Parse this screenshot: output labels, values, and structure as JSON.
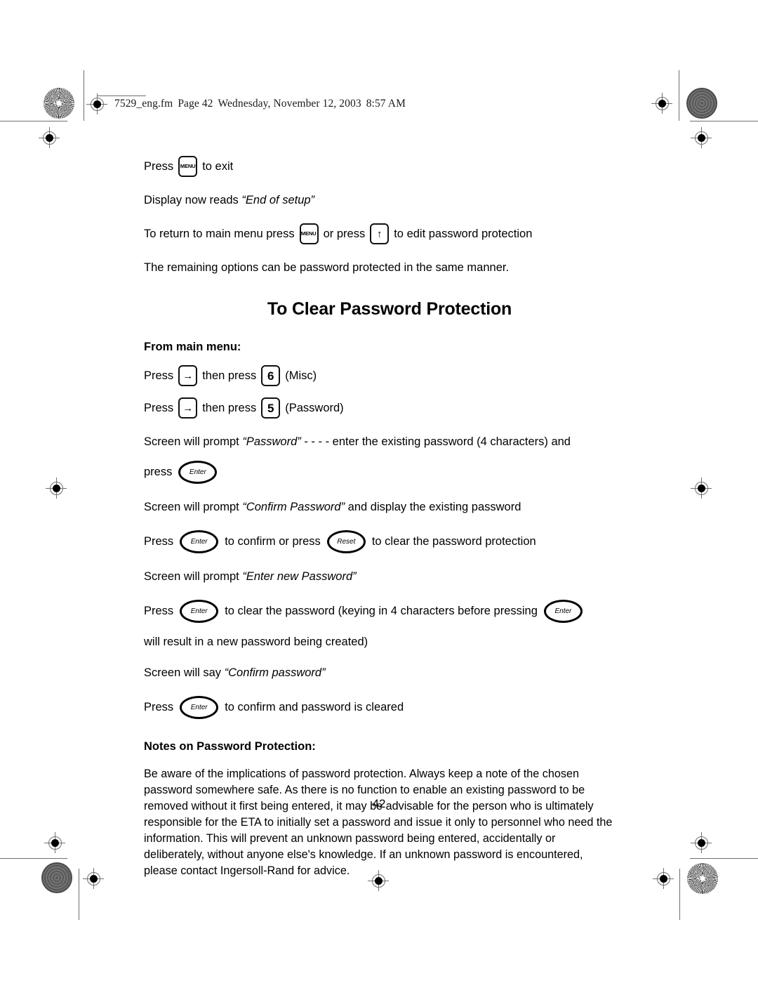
{
  "document": {
    "header_slug": {
      "filename": "7529_eng.fm",
      "page_label": "Page 42",
      "date": "Wednesday, November 12, 2003",
      "time": "8:57 AM"
    },
    "page_number": "42",
    "title": "To Clear Password Protection",
    "subhead": "From main menu:",
    "notes_heading": "Notes on Password Protection:",
    "notes_body": "Be aware of the implications of password protection. Always keep a note of the chosen password somewhere safe. As there is no function to enable an existing password to be removed without it first being entered, it may be advisable for the person who is ultimately responsible for the ETA to initially set a password and issue it only to personnel who need the information. This will prevent an unknown password being entered, accidentally or deliberately, without anyone else's knowledge. If an unknown password is encountered, please contact Ingersoll-Rand for advice."
  },
  "keys": {
    "menu": "MENU",
    "up_arrow": "↑",
    "right_arrow": "→",
    "six": "6",
    "five": "5",
    "enter": "Enter",
    "reset": "Reset"
  },
  "lines": {
    "l1_a": "Press",
    "l1_b": "to exit",
    "l2_a": "Display now reads ",
    "l2_italic": "“End of setup”",
    "l3_a": "To return to main menu press",
    "l3_b": "or press",
    "l3_c": "to edit password protection",
    "l4": "The remaining options can be password protected in the same manner.",
    "l5_a": "Press",
    "l5_b": "then press",
    "l5_c": "(Misc)",
    "l6_a": "Press",
    "l6_b": "then press",
    "l6_c": "(Password)",
    "l7_a": "Screen will prompt ",
    "l7_italic": "“Password”",
    "l7_b": " - - - - enter the existing password (4 characters) and",
    "l8_a": "press",
    "l9_a": "Screen will prompt ",
    "l9_italic": "“Confirm Password”",
    "l9_b": " and display the existing password",
    "l10_a": "Press",
    "l10_b": "to confirm or press",
    "l10_c": "to clear the password protection",
    "l11_a": "Screen will prompt ",
    "l11_italic": "“Enter new Password”",
    "l12_a": "Press",
    "l12_b": "to clear the password (keying in 4 characters before pressing",
    "l13": "will result in a new password being created)",
    "l14_a": "Screen will say ",
    "l14_italic": "“Confirm password”",
    "l15_a": "Press",
    "l15_b": "to confirm and password is cleared"
  }
}
